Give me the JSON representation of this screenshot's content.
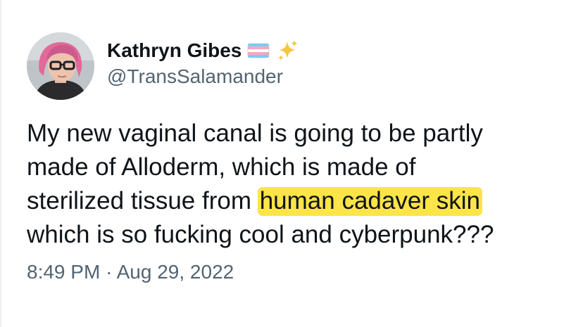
{
  "tweet": {
    "author": {
      "display_name": "Kathryn Gibes",
      "handle": "@TransSalamander",
      "avatar_icon": "profile-photo",
      "emojis": [
        "transgender-flag-icon",
        "sparkles-icon"
      ]
    },
    "text": {
      "line1": "My new vaginal canal is going to be partly",
      "line2": "made of Alloderm, which is made of",
      "line3_prefix": "sterilized tissue from ",
      "line3_highlight": "human cadaver skin",
      "line4": "which is so fucking cool and cyberpunk???"
    },
    "time": "8:49 PM",
    "separator": "·",
    "date": "Aug 29, 2022",
    "colors": {
      "highlight": "#fde449",
      "secondary_text": "#536471",
      "primary_text": "#0f1419"
    }
  }
}
